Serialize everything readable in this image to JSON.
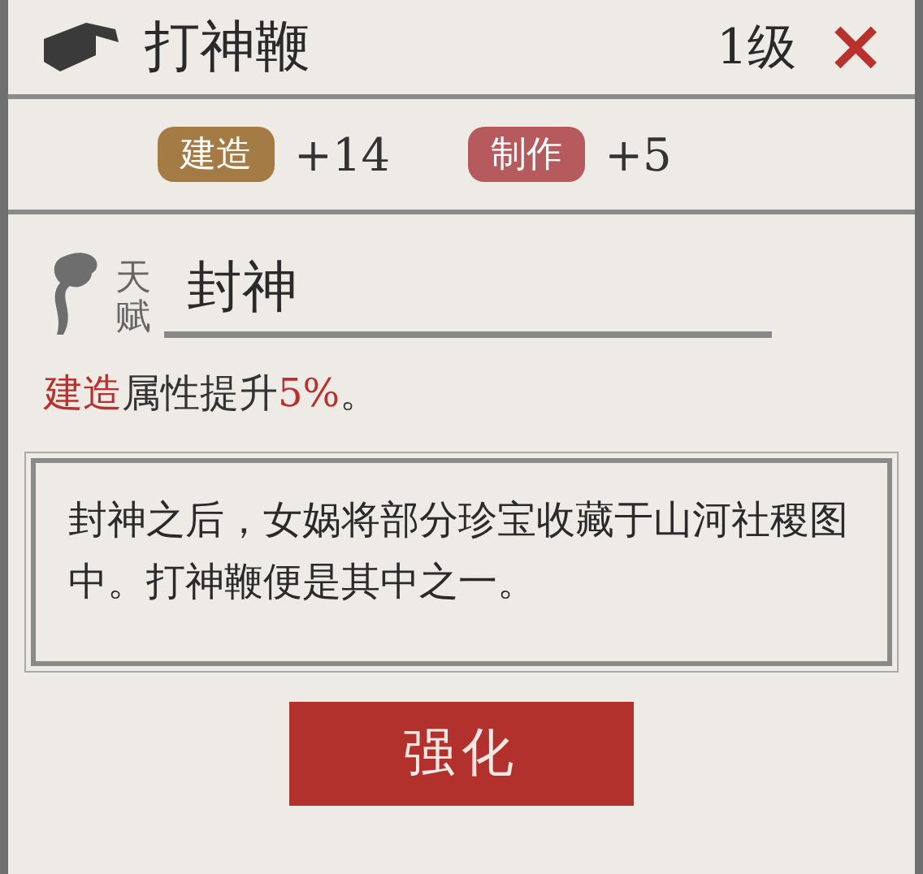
{
  "header": {
    "title": "打神鞭",
    "level": "1级",
    "close": "×"
  },
  "stats": [
    {
      "label": "建造",
      "value": "+14",
      "color": "#a47a45"
    },
    {
      "label": "制作",
      "value": "+5",
      "color": "#b65a5e"
    }
  ],
  "talent": {
    "tag": "天赋",
    "name": "封神"
  },
  "effect": [
    {
      "text": "建造",
      "highlight": true
    },
    {
      "text": "属性提升",
      "highlight": false
    },
    {
      "text": "5%",
      "highlight": true
    },
    {
      "text": "。",
      "highlight": false
    }
  ],
  "description": "封神之后，女娲将部分珍宝收藏于山河社稷图中。打神鞭便是其中之一。",
  "button": "强化"
}
